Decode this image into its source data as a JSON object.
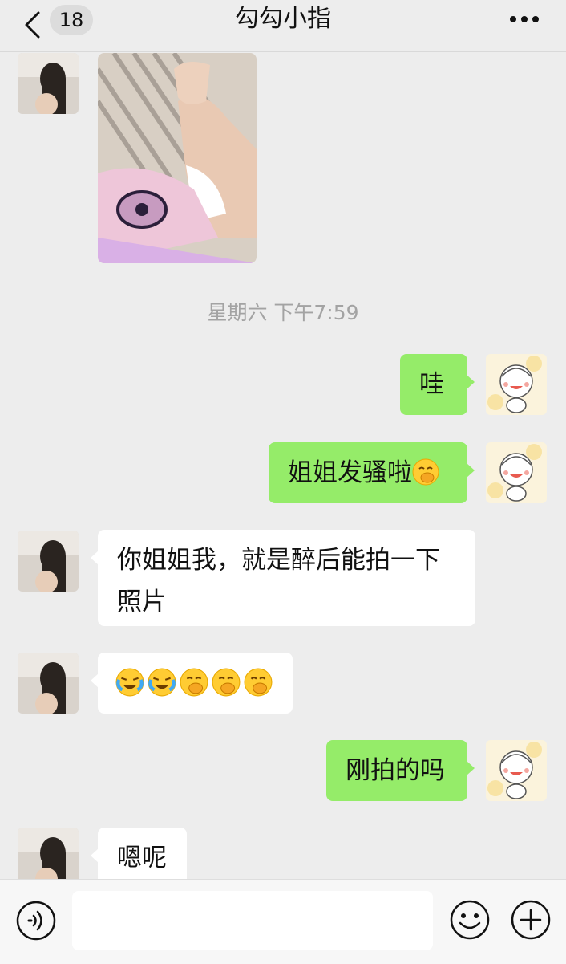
{
  "header": {
    "back_icon": "chevron-left-icon",
    "unread_count": "18",
    "title": "勾勾小指",
    "more_icon": "more-dots-icon"
  },
  "messages": {
    "timestamp": "星期六 下午7:59",
    "m1_text": "哇",
    "m2_text": "姐姐发骚啦",
    "m3_text": "你姐姐我，就是醉后能拍一下照片",
    "m5_text": "刚拍的吗",
    "m6_text": "嗯呢"
  },
  "input_bar": {
    "placeholder": "",
    "voice_icon": "voice-icon",
    "emoji_icon": "smiley-icon",
    "plus_icon": "plus-icon"
  },
  "colors": {
    "outgoing_bubble": "#95ec69",
    "incoming_bubble": "#ffffff",
    "background": "#ededed"
  }
}
